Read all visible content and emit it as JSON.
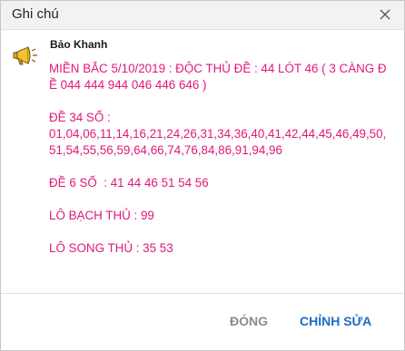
{
  "dialog": {
    "title": "Ghi chú",
    "close_icon": "close-icon"
  },
  "note": {
    "avatar_icon": "megaphone-icon",
    "author": "Bảo Khanh",
    "paragraphs": [
      "MIỀN BẮC 5/10/2019 : ĐỘC THỦ ĐỀ : 44 LÓT 46 ( 3 CÀNG ĐỀ 044 444 944 046 446 646 )",
      "ĐỀ 34 SỐ :\n01,04,06,11,14,16,21,24,26,31,34,36,40,41,42,44,45,46,49,50,51,54,55,56,59,64,66,74,76,84,86,91,94,96",
      "ĐỀ 6 SỐ  : 41 44 46 51 54 56",
      "LÔ BẠCH THỦ : 99",
      "LÔ SONG THỦ : 35 53"
    ],
    "text_color": "#e0197a"
  },
  "footer": {
    "close_label": "ĐÓNG",
    "edit_label": "CHỈNH SỬA",
    "accent_color": "#1a6cc8"
  }
}
